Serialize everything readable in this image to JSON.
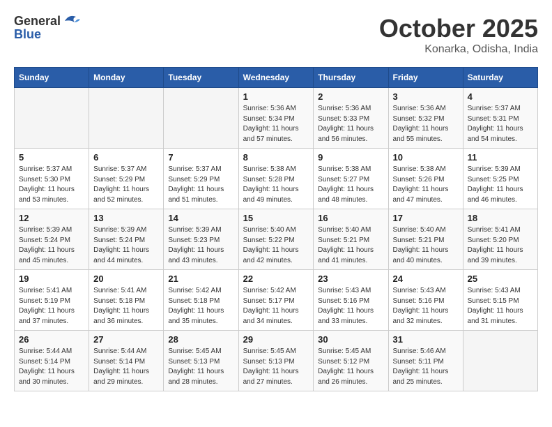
{
  "header": {
    "logo_line1": "General",
    "logo_line2": "Blue",
    "month": "October 2025",
    "location": "Konarka, Odisha, India"
  },
  "weekdays": [
    "Sunday",
    "Monday",
    "Tuesday",
    "Wednesday",
    "Thursday",
    "Friday",
    "Saturday"
  ],
  "weeks": [
    [
      {
        "day": "",
        "detail": ""
      },
      {
        "day": "",
        "detail": ""
      },
      {
        "day": "",
        "detail": ""
      },
      {
        "day": "1",
        "detail": "Sunrise: 5:36 AM\nSunset: 5:34 PM\nDaylight: 11 hours\nand 57 minutes."
      },
      {
        "day": "2",
        "detail": "Sunrise: 5:36 AM\nSunset: 5:33 PM\nDaylight: 11 hours\nand 56 minutes."
      },
      {
        "day": "3",
        "detail": "Sunrise: 5:36 AM\nSunset: 5:32 PM\nDaylight: 11 hours\nand 55 minutes."
      },
      {
        "day": "4",
        "detail": "Sunrise: 5:37 AM\nSunset: 5:31 PM\nDaylight: 11 hours\nand 54 minutes."
      }
    ],
    [
      {
        "day": "5",
        "detail": "Sunrise: 5:37 AM\nSunset: 5:30 PM\nDaylight: 11 hours\nand 53 minutes."
      },
      {
        "day": "6",
        "detail": "Sunrise: 5:37 AM\nSunset: 5:29 PM\nDaylight: 11 hours\nand 52 minutes."
      },
      {
        "day": "7",
        "detail": "Sunrise: 5:37 AM\nSunset: 5:29 PM\nDaylight: 11 hours\nand 51 minutes."
      },
      {
        "day": "8",
        "detail": "Sunrise: 5:38 AM\nSunset: 5:28 PM\nDaylight: 11 hours\nand 49 minutes."
      },
      {
        "day": "9",
        "detail": "Sunrise: 5:38 AM\nSunset: 5:27 PM\nDaylight: 11 hours\nand 48 minutes."
      },
      {
        "day": "10",
        "detail": "Sunrise: 5:38 AM\nSunset: 5:26 PM\nDaylight: 11 hours\nand 47 minutes."
      },
      {
        "day": "11",
        "detail": "Sunrise: 5:39 AM\nSunset: 5:25 PM\nDaylight: 11 hours\nand 46 minutes."
      }
    ],
    [
      {
        "day": "12",
        "detail": "Sunrise: 5:39 AM\nSunset: 5:24 PM\nDaylight: 11 hours\nand 45 minutes."
      },
      {
        "day": "13",
        "detail": "Sunrise: 5:39 AM\nSunset: 5:24 PM\nDaylight: 11 hours\nand 44 minutes."
      },
      {
        "day": "14",
        "detail": "Sunrise: 5:39 AM\nSunset: 5:23 PM\nDaylight: 11 hours\nand 43 minutes."
      },
      {
        "day": "15",
        "detail": "Sunrise: 5:40 AM\nSunset: 5:22 PM\nDaylight: 11 hours\nand 42 minutes."
      },
      {
        "day": "16",
        "detail": "Sunrise: 5:40 AM\nSunset: 5:21 PM\nDaylight: 11 hours\nand 41 minutes."
      },
      {
        "day": "17",
        "detail": "Sunrise: 5:40 AM\nSunset: 5:21 PM\nDaylight: 11 hours\nand 40 minutes."
      },
      {
        "day": "18",
        "detail": "Sunrise: 5:41 AM\nSunset: 5:20 PM\nDaylight: 11 hours\nand 39 minutes."
      }
    ],
    [
      {
        "day": "19",
        "detail": "Sunrise: 5:41 AM\nSunset: 5:19 PM\nDaylight: 11 hours\nand 37 minutes."
      },
      {
        "day": "20",
        "detail": "Sunrise: 5:41 AM\nSunset: 5:18 PM\nDaylight: 11 hours\nand 36 minutes."
      },
      {
        "day": "21",
        "detail": "Sunrise: 5:42 AM\nSunset: 5:18 PM\nDaylight: 11 hours\nand 35 minutes."
      },
      {
        "day": "22",
        "detail": "Sunrise: 5:42 AM\nSunset: 5:17 PM\nDaylight: 11 hours\nand 34 minutes."
      },
      {
        "day": "23",
        "detail": "Sunrise: 5:43 AM\nSunset: 5:16 PM\nDaylight: 11 hours\nand 33 minutes."
      },
      {
        "day": "24",
        "detail": "Sunrise: 5:43 AM\nSunset: 5:16 PM\nDaylight: 11 hours\nand 32 minutes."
      },
      {
        "day": "25",
        "detail": "Sunrise: 5:43 AM\nSunset: 5:15 PM\nDaylight: 11 hours\nand 31 minutes."
      }
    ],
    [
      {
        "day": "26",
        "detail": "Sunrise: 5:44 AM\nSunset: 5:14 PM\nDaylight: 11 hours\nand 30 minutes."
      },
      {
        "day": "27",
        "detail": "Sunrise: 5:44 AM\nSunset: 5:14 PM\nDaylight: 11 hours\nand 29 minutes."
      },
      {
        "day": "28",
        "detail": "Sunrise: 5:45 AM\nSunset: 5:13 PM\nDaylight: 11 hours\nand 28 minutes."
      },
      {
        "day": "29",
        "detail": "Sunrise: 5:45 AM\nSunset: 5:13 PM\nDaylight: 11 hours\nand 27 minutes."
      },
      {
        "day": "30",
        "detail": "Sunrise: 5:45 AM\nSunset: 5:12 PM\nDaylight: 11 hours\nand 26 minutes."
      },
      {
        "day": "31",
        "detail": "Sunrise: 5:46 AM\nSunset: 5:11 PM\nDaylight: 11 hours\nand 25 minutes."
      },
      {
        "day": "",
        "detail": ""
      }
    ]
  ]
}
